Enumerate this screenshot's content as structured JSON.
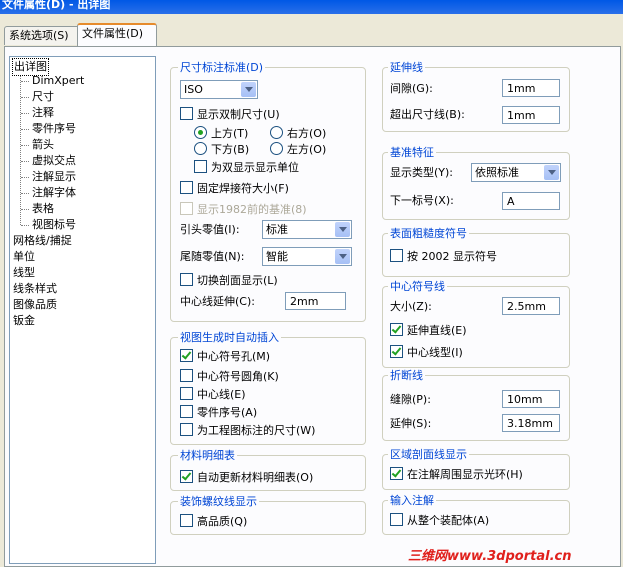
{
  "window": {
    "title": "文件属性(D) - 出详图"
  },
  "tabs": [
    {
      "label": "系统选项(S)"
    },
    {
      "label": "文件属性(D)"
    }
  ],
  "tree": {
    "root": "出详图",
    "children": [
      "DimXpert",
      "尺寸",
      "注释",
      "零件序号",
      "箭头",
      "虚拟交点",
      "注解显示",
      "注解字体",
      "表格",
      "视图标号"
    ],
    "top_items": [
      "网格线/捕捉",
      "单位",
      "线型",
      "线条样式",
      "图像品质",
      "钣金"
    ]
  },
  "dim": {
    "title": "尺寸标注标准(D)",
    "standard": "ISO",
    "dual_label": "显示双制尺寸(U)",
    "radio_top": "上方(T)",
    "radio_right": "右方(O)",
    "radio_bottom": "下方(B)",
    "radio_left": "左方(O)",
    "dual_unit": "为双显示显示单位",
    "fixed_weld": "固定焊接符大小(F)",
    "display_1982": "显示1982前的基准(8)",
    "leading_zero_label": "引头零值(I):",
    "leading_zero": "标准",
    "trailing_zero_label": "尾随零值(N):",
    "trailing_zero": "智能",
    "toggle_section": "切换剖面显示(L)",
    "centerline_ext_label": "中心线延伸(C):",
    "centerline_ext": "2mm"
  },
  "auto_insert": {
    "title": "视图生成时自动插入",
    "items": [
      {
        "label": "中心符号孔(M)",
        "checked": true
      },
      {
        "label": "中心符号圆角(K)",
        "checked": false
      },
      {
        "label": "中心线(E)",
        "checked": false
      },
      {
        "label": "零件序号(A)",
        "checked": false
      },
      {
        "label": "为工程图标注的尺寸(W)",
        "checked": false
      }
    ]
  },
  "bom": {
    "title": "材料明细表",
    "auto_update": "自动更新材料明细表(O)"
  },
  "cosmetic_thread": {
    "title": "装饰螺纹线显示",
    "high_quality": "高品质(Q)"
  },
  "extension": {
    "title": "延伸线",
    "gap_label": "间隙(G):",
    "gap": "1mm",
    "beyond_label": "超出尺寸线(B):",
    "beyond": "1mm"
  },
  "datum": {
    "title": "基准特征",
    "type_label": "显示类型(Y):",
    "type": "依照标准",
    "next_label": "下一标号(X):",
    "next": "A"
  },
  "surface_finish": {
    "title": "表面粗糙度符号",
    "iso2002": "按 2002 显示符号"
  },
  "center_mark": {
    "title": "中心符号线",
    "size_label": "大小(Z):",
    "size": "2.5mm",
    "extended": "延伸直线(E)",
    "centerline_type": "中心线型(I)"
  },
  "break_line": {
    "title": "折断线",
    "gap_label": "缝隙(P):",
    "gap": "10mm",
    "ext_label": "延伸(S):",
    "ext": "3.18mm"
  },
  "area_hatch": {
    "title": "区域剖面线显示",
    "halo": "在注解周围显示光环(H)"
  },
  "import_ann": {
    "title": "输入注解",
    "from_assembly": "从整个装配体(A)"
  },
  "watermark": "三维网www.3dportal.cn"
}
